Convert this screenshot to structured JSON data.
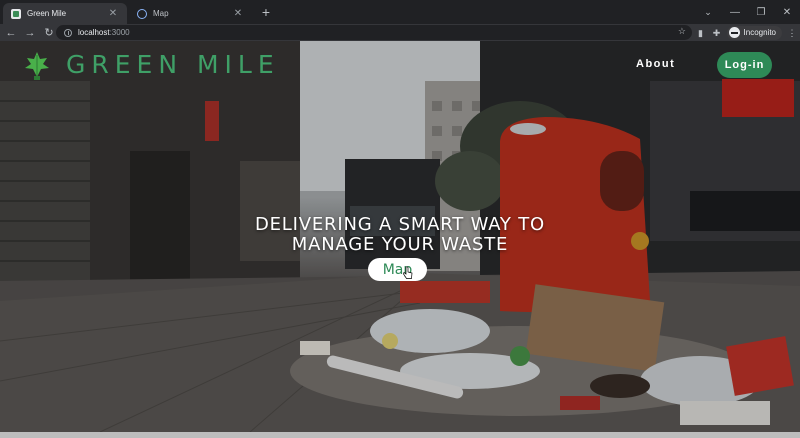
{
  "browser": {
    "tabs": [
      {
        "title": "Green Mile",
        "active": true,
        "favicon": "site-favicon"
      },
      {
        "title": "Map",
        "active": false,
        "favicon": "loading-globe-icon"
      }
    ],
    "new_tab_symbol": "+",
    "address": {
      "host": "localhost",
      "port": ":3000"
    },
    "profile_label": "Incognito"
  },
  "site": {
    "brand": "GREEN MILE",
    "nav": {
      "about": "About",
      "login": "Log-in"
    },
    "hero": {
      "line1": "DELIVERING A SMART WAY TO",
      "line2": "MANAGE YOUR WASTE",
      "cta": "Map"
    }
  },
  "colors": {
    "brand_green": "#3fa067",
    "button_green": "#2e8a57",
    "chrome_dark": "#202124",
    "chrome_toolbar": "#35363a"
  }
}
